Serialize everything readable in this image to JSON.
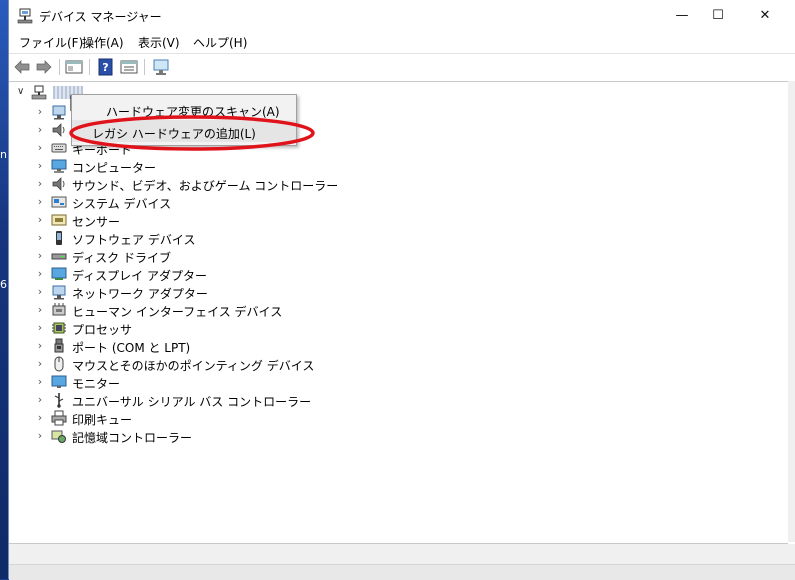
{
  "window": {
    "title": "デバイス マネージャー",
    "controls": {
      "minimize": "—",
      "maximize": "☐",
      "close": "✕"
    }
  },
  "menubar": [
    {
      "label": "ファイル(F)"
    },
    {
      "label": "操作(A)"
    },
    {
      "label": "表示(V)"
    },
    {
      "label": "ヘルプ(H)"
    }
  ],
  "desktop": {
    "glyphs": [
      "ni",
      "6"
    ]
  },
  "tree": {
    "items": [
      {
        "label": "",
        "icon": "network-adapter-icon"
      },
      {
        "label": "",
        "icon": "speaker-icon"
      },
      {
        "label": "キーボード",
        "icon": "keyboard-icon"
      },
      {
        "label": "コンピューター",
        "icon": "computer-icon"
      },
      {
        "label": "サウンド、ビデオ、およびゲーム コントローラー",
        "icon": "speaker-icon"
      },
      {
        "label": "システム デバイス",
        "icon": "system-device-icon"
      },
      {
        "label": "センサー",
        "icon": "sensor-icon"
      },
      {
        "label": "ソフトウェア デバイス",
        "icon": "software-device-icon"
      },
      {
        "label": "ディスク ドライブ",
        "icon": "disk-drive-icon"
      },
      {
        "label": "ディスプレイ アダプター",
        "icon": "display-adapter-icon"
      },
      {
        "label": "ネットワーク アダプター",
        "icon": "network-adapter-icon"
      },
      {
        "label": "ヒューマン インターフェイス デバイス",
        "icon": "hid-icon"
      },
      {
        "label": "プロセッサ",
        "icon": "processor-icon"
      },
      {
        "label": "ポート (COM と LPT)",
        "icon": "port-icon"
      },
      {
        "label": "マウスとそのほかのポインティング デバイス",
        "icon": "mouse-icon"
      },
      {
        "label": "モニター",
        "icon": "monitor-icon"
      },
      {
        "label": "ユニバーサル シリアル バス コントローラー",
        "icon": "usb-icon"
      },
      {
        "label": "印刷キュー",
        "icon": "printer-icon"
      },
      {
        "label": "記憶域コントローラー",
        "icon": "storage-controller-icon"
      }
    ]
  },
  "context_menu": {
    "items": [
      {
        "label": "ハードウェア変更のスキャン(A)"
      },
      {
        "label": "レガシ ハードウェアの追加(L)"
      }
    ]
  },
  "colors": {
    "annotation": "#e0121a",
    "window_border": "#6f8fbf",
    "desktop": "#1c3f8a"
  }
}
